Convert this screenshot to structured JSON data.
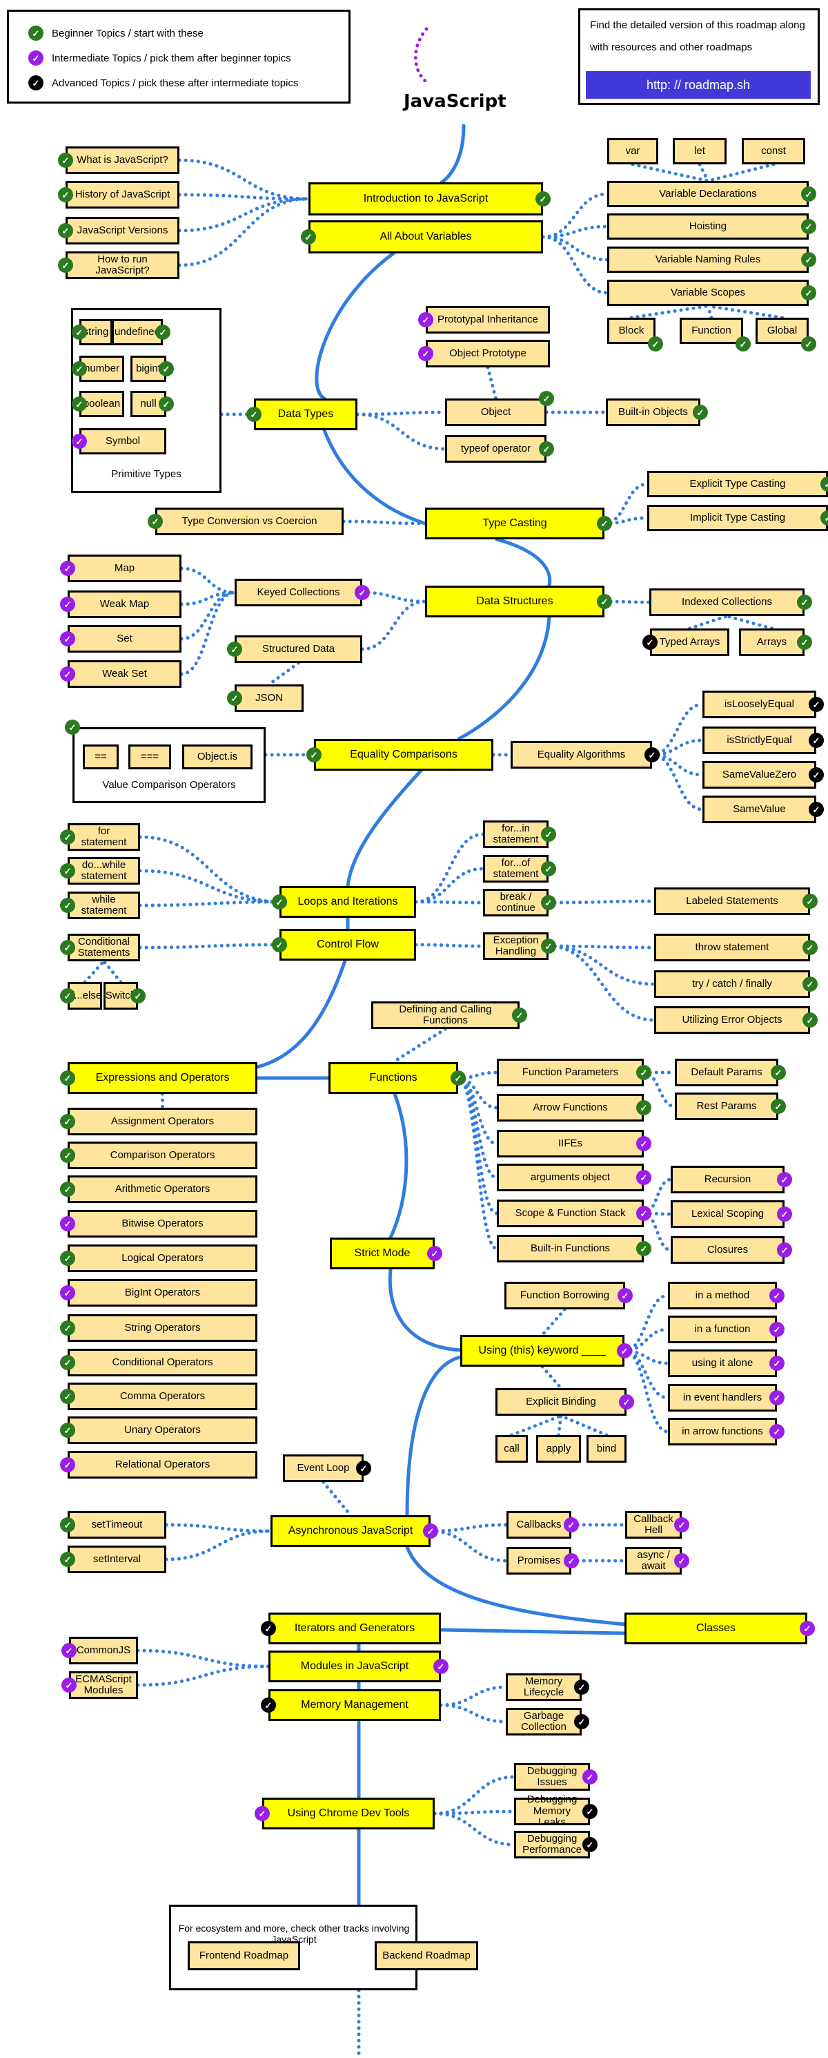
{
  "title": "JavaScript",
  "legend": [
    {
      "level": "beginner",
      "text": "Beginner Topics / start with these"
    },
    {
      "level": "intermediate",
      "text": "Intermediate Topics / pick them after beginner topics"
    },
    {
      "level": "advanced",
      "text": "Advanced Topics / pick these after intermediate topics"
    }
  ],
  "info": {
    "text": "Find the detailed version of this roadmap along with resources and other roadmaps",
    "link": "http: // roadmap.sh"
  },
  "colors": {
    "beginner": "#2b7a1f",
    "intermediate": "#9b1de8",
    "advanced": "#000000",
    "main_node": "#ffff00",
    "sub_node": "#fee49c",
    "connector": "#2f7de1",
    "link_button": "#4338d8"
  },
  "group_labels": {
    "primitive_types": "Primitive Types",
    "value_comparison": "Value Comparison Operators"
  },
  "footer": {
    "text": "For ecosystem and more, check other tracks involving JavaScript",
    "buttons": [
      "Frontend Roadmap",
      "Backend Roadmap"
    ]
  },
  "nodes": [
    {
      "id": "intro",
      "label": "Introduction to JavaScript",
      "main": true,
      "level": "beginner"
    },
    {
      "id": "variables",
      "label": "All About Variables",
      "main": true,
      "level": "beginner"
    },
    {
      "id": "what",
      "label": "What is JavaScript?",
      "level": "beginner"
    },
    {
      "id": "history",
      "label": "History of JavaScript",
      "level": "beginner"
    },
    {
      "id": "versions",
      "label": "JavaScript Versions",
      "level": "beginner"
    },
    {
      "id": "howrun",
      "label": "How to run JavaScript?",
      "level": "beginner"
    },
    {
      "id": "var",
      "label": "var"
    },
    {
      "id": "let",
      "label": "let"
    },
    {
      "id": "const",
      "label": "const"
    },
    {
      "id": "vardecl",
      "label": "Variable Declarations",
      "level": "beginner"
    },
    {
      "id": "hoisting",
      "label": "Hoisting",
      "level": "beginner"
    },
    {
      "id": "naming",
      "label": "Variable Naming Rules",
      "level": "beginner"
    },
    {
      "id": "scopes",
      "label": "Variable Scopes",
      "level": "beginner"
    },
    {
      "id": "block",
      "label": "Block",
      "level": "beginner"
    },
    {
      "id": "function_scope",
      "label": "Function",
      "level": "beginner"
    },
    {
      "id": "global",
      "label": "Global",
      "level": "beginner"
    },
    {
      "id": "string",
      "label": "string",
      "level": "beginner"
    },
    {
      "id": "undefined",
      "label": "undefined",
      "level": "beginner"
    },
    {
      "id": "number",
      "label": "number",
      "level": "beginner"
    },
    {
      "id": "bigint",
      "label": "bigint",
      "level": "beginner"
    },
    {
      "id": "boolean",
      "label": "boolean",
      "level": "beginner"
    },
    {
      "id": "null",
      "label": "null",
      "level": "beginner"
    },
    {
      "id": "symbol",
      "label": "Symbol",
      "level": "intermediate"
    },
    {
      "id": "datatypes",
      "label": "Data Types",
      "main": true,
      "level": "beginner"
    },
    {
      "id": "protoinh",
      "label": "Prototypal Inheritance",
      "level": "intermediate"
    },
    {
      "id": "objproto",
      "label": "Object Prototype",
      "level": "intermediate"
    },
    {
      "id": "object",
      "label": "Object",
      "level": "beginner"
    },
    {
      "id": "typeof",
      "label": "typeof operator",
      "level": "beginner"
    },
    {
      "id": "builtinobj",
      "label": "Built-in Objects",
      "level": "beginner"
    },
    {
      "id": "typecasting",
      "label": "Type Casting",
      "main": true,
      "level": "beginner"
    },
    {
      "id": "convcoerce",
      "label": "Type Conversion vs Coercion",
      "level": "beginner"
    },
    {
      "id": "explicitcast",
      "label": "Explicit Type Casting",
      "level": "beginner"
    },
    {
      "id": "implicitcast",
      "label": "Implicit Type Casting",
      "level": "beginner"
    },
    {
      "id": "datastructures",
      "label": "Data Structures",
      "main": true,
      "level": "beginner"
    },
    {
      "id": "keyed",
      "label": "Keyed Collections",
      "level": "intermediate"
    },
    {
      "id": "map",
      "label": "Map",
      "level": "intermediate"
    },
    {
      "id": "weakmap",
      "label": "Weak Map",
      "level": "intermediate"
    },
    {
      "id": "set",
      "label": "Set",
      "level": "intermediate"
    },
    {
      "id": "weakset",
      "label": "Weak Set",
      "level": "intermediate"
    },
    {
      "id": "structured",
      "label": "Structured Data",
      "level": "beginner"
    },
    {
      "id": "json",
      "label": "JSON",
      "level": "beginner"
    },
    {
      "id": "indexed",
      "label": "Indexed Collections",
      "level": "beginner"
    },
    {
      "id": "typedarrays",
      "label": "Typed Arrays",
      "level": "advanced"
    },
    {
      "id": "arrays",
      "label": "Arrays",
      "level": "beginner"
    },
    {
      "id": "equality",
      "label": "Equality Comparisons",
      "main": true,
      "level": "beginner"
    },
    {
      "id": "eq2",
      "label": "=="
    },
    {
      "id": "eq3",
      "label": "==="
    },
    {
      "id": "objectis",
      "label": "Object.is"
    },
    {
      "id": "eqalgo",
      "label": "Equality Algorithms",
      "level": "advanced"
    },
    {
      "id": "loosely",
      "label": "isLooselyEqual",
      "level": "advanced"
    },
    {
      "id": "strictly",
      "label": "isStrictlyEqual",
      "level": "advanced"
    },
    {
      "id": "samezero",
      "label": "SameValueZero",
      "level": "advanced"
    },
    {
      "id": "samevalue",
      "label": "SameValue",
      "level": "advanced"
    },
    {
      "id": "loops",
      "label": "Loops and Iterations",
      "main": true,
      "level": "beginner"
    },
    {
      "id": "forstmt",
      "label": "for statement",
      "level": "beginner"
    },
    {
      "id": "dowhile",
      "label": "do...while statement",
      "level": "beginner"
    },
    {
      "id": "whilestmt",
      "label": "while statement",
      "level": "beginner"
    },
    {
      "id": "forin",
      "label": "for...in statement",
      "level": "beginner"
    },
    {
      "id": "forof",
      "label": "for...of statement",
      "level": "beginner"
    },
    {
      "id": "breakcont",
      "label": "break / continue",
      "level": "beginner"
    },
    {
      "id": "labeled",
      "label": "Labeled Statements",
      "level": "beginner"
    },
    {
      "id": "controlflow",
      "label": "Control Flow",
      "main": true,
      "level": "beginner"
    },
    {
      "id": "conditional",
      "label": "Conditional Statements",
      "level": "beginner"
    },
    {
      "id": "ifelse",
      "label": "If...else",
      "level": "beginner"
    },
    {
      "id": "switch",
      "label": "Switch",
      "level": "beginner"
    },
    {
      "id": "exception",
      "label": "Exception Handling",
      "level": "beginner"
    },
    {
      "id": "throw",
      "label": "throw statement",
      "level": "beginner"
    },
    {
      "id": "trycatch",
      "label": "try / catch / finally",
      "level": "beginner"
    },
    {
      "id": "errorobj",
      "label": "Utilizing Error Objects",
      "level": "beginner"
    },
    {
      "id": "defcall",
      "label": "Defining and Calling Functions",
      "level": "beginner"
    },
    {
      "id": "expressions",
      "label": "Expressions and Operators",
      "main": true,
      "level": "beginner"
    },
    {
      "id": "assignop",
      "label": "Assignment Operators",
      "level": "beginner"
    },
    {
      "id": "compop",
      "label": "Comparison Operators",
      "level": "beginner"
    },
    {
      "id": "arithop",
      "label": "Arithmetic Operators",
      "level": "beginner"
    },
    {
      "id": "bitwiseop",
      "label": "Bitwise Operators",
      "level": "intermediate"
    },
    {
      "id": "logicalop",
      "label": "Logical Operators",
      "level": "beginner"
    },
    {
      "id": "bigintop",
      "label": "BigInt Operators",
      "level": "intermediate"
    },
    {
      "id": "stringop",
      "label": "String Operators",
      "level": "beginner"
    },
    {
      "id": "condop",
      "label": "Conditional Operators",
      "level": "beginner"
    },
    {
      "id": "commaop",
      "label": "Comma Operators",
      "level": "beginner"
    },
    {
      "id": "unaryop",
      "label": "Unary Operators",
      "level": "beginner"
    },
    {
      "id": "relop",
      "label": "Relational Operators",
      "level": "intermediate"
    },
    {
      "id": "functions",
      "label": "Functions",
      "main": true,
      "level": "beginner"
    },
    {
      "id": "funcparams",
      "label": "Function Parameters",
      "level": "beginner"
    },
    {
      "id": "defaultparams",
      "label": "Default Params",
      "level": "beginner"
    },
    {
      "id": "restparams",
      "label": "Rest Params",
      "level": "beginner"
    },
    {
      "id": "arrowfn",
      "label": "Arrow Functions",
      "level": "beginner"
    },
    {
      "id": "iifes",
      "label": "IIFEs",
      "level": "intermediate"
    },
    {
      "id": "argsobj",
      "label": "arguments object",
      "level": "intermediate"
    },
    {
      "id": "scopestack",
      "label": "Scope & Function Stack",
      "level": "intermediate"
    },
    {
      "id": "recursion",
      "label": "Recursion",
      "level": "intermediate"
    },
    {
      "id": "lexical",
      "label": "Lexical Scoping",
      "level": "intermediate"
    },
    {
      "id": "closures",
      "label": "Closures",
      "level": "intermediate"
    },
    {
      "id": "builtinfn",
      "label": "Built-in Functions",
      "level": "beginner"
    },
    {
      "id": "strict",
      "label": "Strict Mode",
      "main": true,
      "level": "intermediate"
    },
    {
      "id": "fnborrow",
      "label": "Function Borrowing",
      "level": "intermediate"
    },
    {
      "id": "thiskw",
      "label": "Using (this) keyword ____",
      "main": true,
      "level": "intermediate"
    },
    {
      "id": "inmethod",
      "label": "in a method",
      "level": "intermediate"
    },
    {
      "id": "infunction",
      "label": "in a function",
      "level": "intermediate"
    },
    {
      "id": "alone",
      "label": "using it alone",
      "level": "intermediate"
    },
    {
      "id": "eventhandlers",
      "label": "in event handlers",
      "level": "intermediate"
    },
    {
      "id": "arrowthis",
      "label": "in arrow functions",
      "level": "intermediate"
    },
    {
      "id": "explicitbind",
      "label": "Explicit Binding",
      "level": "intermediate"
    },
    {
      "id": "call",
      "label": "call"
    },
    {
      "id": "apply",
      "label": "apply"
    },
    {
      "id": "bind",
      "label": "bind"
    },
    {
      "id": "eventloop",
      "label": "Event Loop",
      "level": "advanced"
    },
    {
      "id": "async",
      "label": "Asynchronous JavaScript",
      "main": true,
      "level": "intermediate"
    },
    {
      "id": "settimeout",
      "label": "setTimeout",
      "level": "beginner"
    },
    {
      "id": "setinterval",
      "label": "setInterval",
      "level": "beginner"
    },
    {
      "id": "callbacks",
      "label": "Callbacks",
      "level": "intermediate"
    },
    {
      "id": "callbackhell",
      "label": "Callback Hell",
      "level": "intermediate"
    },
    {
      "id": "promises",
      "label": "Promises",
      "level": "intermediate"
    },
    {
      "id": "asyncawait",
      "label": "async / await",
      "level": "intermediate"
    },
    {
      "id": "classes",
      "label": "Classes",
      "main": true,
      "level": "intermediate"
    },
    {
      "id": "iterators",
      "label": "Iterators and Generators",
      "main": true,
      "level": "advanced"
    },
    {
      "id": "modules",
      "label": "Modules in JavaScript",
      "main": true,
      "level": "intermediate"
    },
    {
      "id": "commonjs",
      "label": "CommonJS",
      "level": "intermediate"
    },
    {
      "id": "esm",
      "label": "ECMAScript Modules",
      "level": "intermediate"
    },
    {
      "id": "memory",
      "label": "Memory Management",
      "main": true,
      "level": "advanced"
    },
    {
      "id": "memlifecycle",
      "label": "Memory Lifecycle",
      "level": "advanced"
    },
    {
      "id": "gc",
      "label": "Garbage Collection",
      "level": "advanced"
    },
    {
      "id": "devtools",
      "label": "Using Chrome Dev Tools",
      "main": true,
      "level": "intermediate"
    },
    {
      "id": "debugissues",
      "label": "Debugging Issues",
      "level": "intermediate"
    },
    {
      "id": "debugleaks",
      "label": "Debugging Memory Leaks",
      "level": "advanced"
    },
    {
      "id": "debugperf",
      "label": "Debugging Performance",
      "level": "advanced"
    }
  ]
}
